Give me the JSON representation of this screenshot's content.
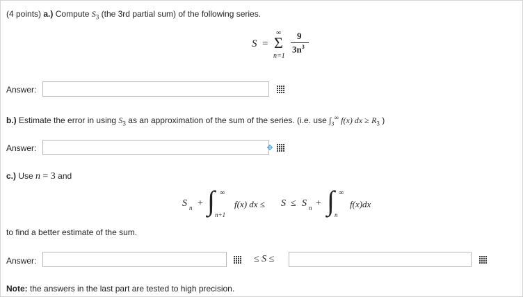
{
  "question": {
    "part_a": {
      "points": "(4 points)",
      "label": "a.)",
      "text_pre": "Compute",
      "sym": "S",
      "sub": "3",
      "text_post": "(the 3rd partial sum) of the following series.",
      "formula": {
        "lhs": "S",
        "eq": "=",
        "sigma": "Σ",
        "upper": "∞",
        "lower": "n=1",
        "numerator": "9",
        "den_coef": "3n",
        "den_exp": "3"
      },
      "answer_label": "Answer:",
      "answer_value": ""
    },
    "part_b": {
      "label": "b.)",
      "text_pre": "Estimate the error in using",
      "sym": "S",
      "sub": "3",
      "text_mid": "as an approximation of the sum of the series. (i.e. use",
      "int_sym": "∫",
      "int_lower": "3",
      "int_upper": "∞",
      "integrand": "f(x) dx ≥",
      "r_sym": "R",
      "r_sub": "3",
      "close": ")",
      "answer_label": "Answer:",
      "answer_value": ""
    },
    "part_c": {
      "label": "c.)",
      "text_pre": "Use",
      "n_sym": "n",
      "eq": "= 3",
      "text_post": "and",
      "ineq": {
        "left_s": "S",
        "left_sub": "n",
        "plus1": "+",
        "int1_upper": "∞",
        "int1_lower": "n+1",
        "int1_body": "f(x) dx ≤",
        "mid_s": "S",
        "le": "≤",
        "right_s": "S",
        "right_sub": "n",
        "plus2": "+",
        "int2_upper": "∞",
        "int2_lower": "n",
        "int2_body": "f(x)dx"
      },
      "text_after": "to find a better estimate of the sum.",
      "answer_label": "Answer:",
      "lower_value": "",
      "middle_text": "≤ S ≤",
      "upper_value": ""
    },
    "note": {
      "label": "Note:",
      "text": "the answers in the last part are tested to high precision."
    }
  },
  "icons": {
    "matrix": "matrix-grid-icon",
    "cursor": "move-cursor-icon"
  }
}
